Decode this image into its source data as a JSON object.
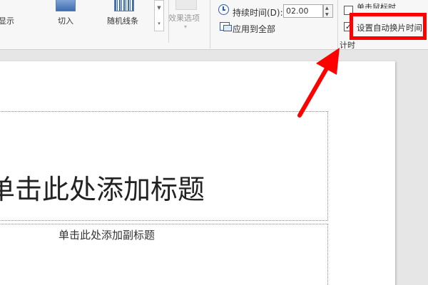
{
  "ribbon": {
    "display_label": "显示",
    "cut_label": "切入",
    "random_bars_label": "随机线条",
    "effect_options_label": "效果选项",
    "duration_label": "持续时间(D):",
    "duration_value": "02.00",
    "apply_all_label": "应用到全部",
    "on_click_label": "单击鼠标时",
    "auto_advance_label": "设置自动换片时间",
    "timing_group_label": "计时"
  },
  "slide": {
    "title_placeholder": "单击此处添加标题",
    "subtitle_placeholder": "单击此处添加副标题"
  },
  "colors": {
    "highlight_box": "#ff0000",
    "arrow": "#ff0000",
    "icon_blue": "#2f5e9e"
  }
}
